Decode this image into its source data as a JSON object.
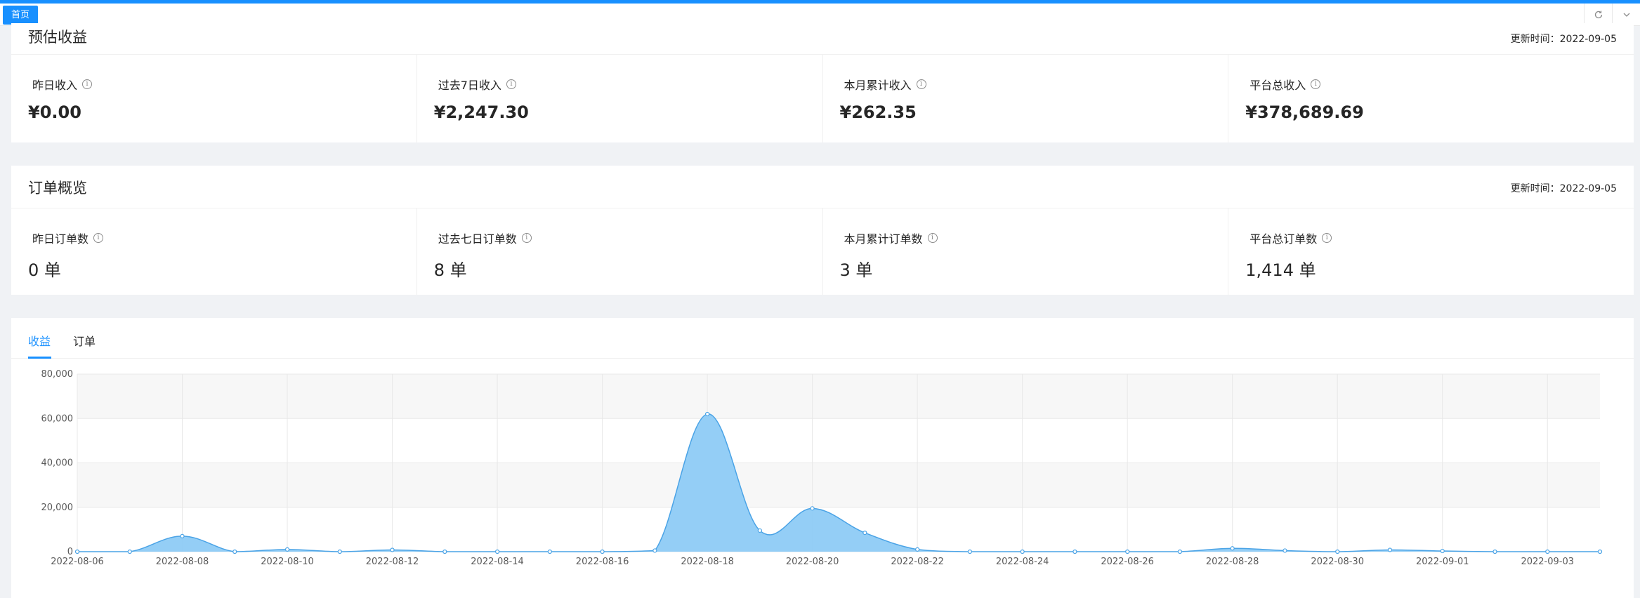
{
  "tabbar": {
    "home_label": "首页",
    "refresh_icon": "refresh-icon",
    "dropdown_icon": "chevron-down-icon"
  },
  "revenue": {
    "title": "预估收益",
    "updated": "更新时间：2022-09-05",
    "stats": [
      {
        "label": "昨日收入",
        "value": "¥0.00"
      },
      {
        "label": "过去7日收入",
        "value": "¥2,247.30"
      },
      {
        "label": "本月累计收入",
        "value": "¥262.35"
      },
      {
        "label": "平台总收入",
        "value": "¥378,689.69"
      }
    ]
  },
  "orders": {
    "title": "订单概览",
    "updated": "更新时间：2022-09-05",
    "stats": [
      {
        "label": "昨日订单数",
        "value": "0 单"
      },
      {
        "label": "过去七日订单数",
        "value": "8 单"
      },
      {
        "label": "本月累计订单数",
        "value": "3 单"
      },
      {
        "label": "平台总订单数",
        "value": "1,414 单"
      }
    ]
  },
  "chart_tabs": [
    {
      "label": "收益",
      "active": true
    },
    {
      "label": "订单",
      "active": false
    }
  ],
  "chart_data": {
    "type": "area",
    "title": "",
    "xlabel": "",
    "ylabel": "",
    "ylim": [
      0,
      80000
    ],
    "yticks": [
      0,
      20000,
      40000,
      60000,
      80000
    ],
    "ytick_labels": [
      "0",
      "20,000",
      "40,000",
      "60,000",
      "80,000"
    ],
    "x": [
      "2022-08-06",
      "2022-08-07",
      "2022-08-08",
      "2022-08-09",
      "2022-08-10",
      "2022-08-11",
      "2022-08-12",
      "2022-08-13",
      "2022-08-14",
      "2022-08-15",
      "2022-08-16",
      "2022-08-17",
      "2022-08-18",
      "2022-08-19",
      "2022-08-20",
      "2022-08-21",
      "2022-08-22",
      "2022-08-23",
      "2022-08-24",
      "2022-08-25",
      "2022-08-26",
      "2022-08-27",
      "2022-08-28",
      "2022-08-29",
      "2022-08-30",
      "2022-08-31",
      "2022-09-01",
      "2022-09-02",
      "2022-09-03",
      "2022-09-04"
    ],
    "xtick_labels": [
      "2022-08-06",
      "2022-08-08",
      "2022-08-10",
      "2022-08-12",
      "2022-08-14",
      "2022-08-16",
      "2022-08-18",
      "2022-08-20",
      "2022-08-22",
      "2022-08-24",
      "2022-08-26",
      "2022-08-28",
      "2022-08-30",
      "2022-09-01",
      "2022-09-03"
    ],
    "series": [
      {
        "values": [
          0,
          0,
          7000,
          0,
          1000,
          0,
          800,
          0,
          0,
          0,
          0,
          500,
          62000,
          9500,
          19500,
          8500,
          1000,
          0,
          0,
          0,
          0,
          0,
          1500,
          500,
          0,
          800,
          300,
          0,
          0,
          0
        ]
      }
    ],
    "grid": true,
    "colors": {
      "line": "#4aa3e6",
      "fill": "#8ecbf5",
      "band": "#f7f7f7",
      "grid": "#e8e8e8"
    }
  }
}
